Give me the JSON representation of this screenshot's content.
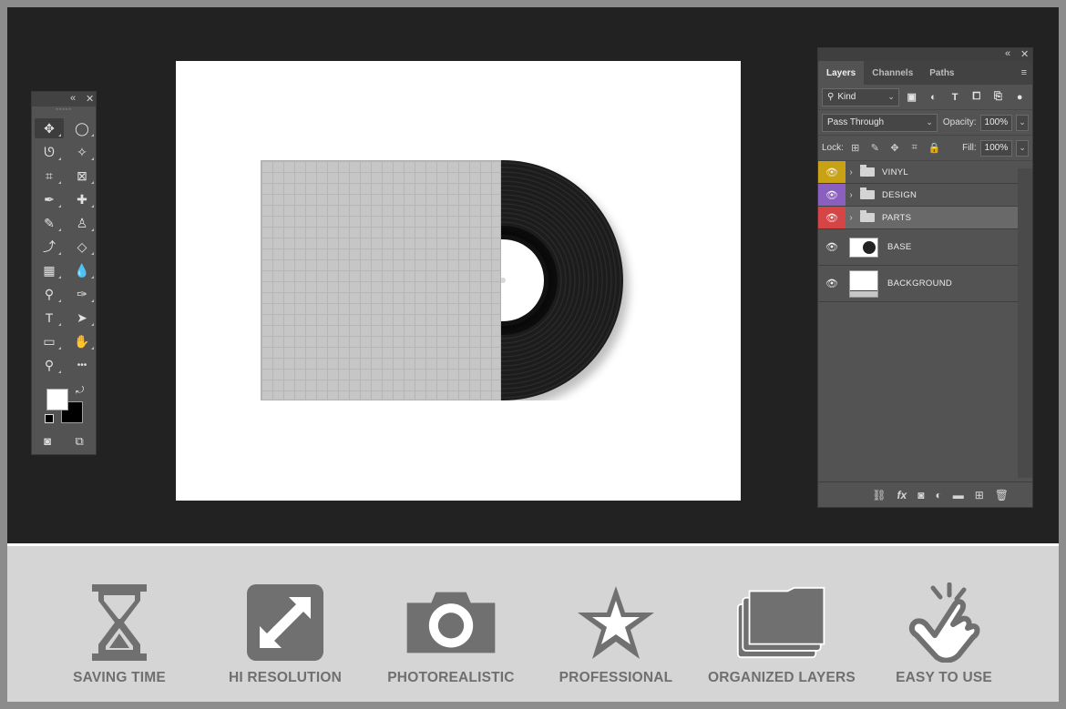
{
  "canvas": {
    "sleeve_color": "#c6c6c6",
    "record_color": "#1c1c1c"
  },
  "toolbar": {
    "tools": [
      {
        "name": "move-tool",
        "glyph": "✥",
        "active": true
      },
      {
        "name": "marquee-ellipse-tool",
        "glyph": "◯"
      },
      {
        "name": "lasso-tool",
        "glyph": "ᘎ"
      },
      {
        "name": "magic-wand-tool",
        "glyph": "✧"
      },
      {
        "name": "crop-tool",
        "glyph": "⌗"
      },
      {
        "name": "frame-tool",
        "glyph": "⊠"
      },
      {
        "name": "eyedropper-tool",
        "glyph": "✒"
      },
      {
        "name": "healing-brush-tool",
        "glyph": "✚"
      },
      {
        "name": "brush-tool",
        "glyph": "✎"
      },
      {
        "name": "clone-stamp-tool",
        "glyph": "♙"
      },
      {
        "name": "history-brush-tool",
        "glyph": "⤴"
      },
      {
        "name": "eraser-tool",
        "glyph": "◇"
      },
      {
        "name": "gradient-tool",
        "glyph": "▦"
      },
      {
        "name": "blur-tool",
        "glyph": "💧"
      },
      {
        "name": "dodge-tool",
        "glyph": "⚲"
      },
      {
        "name": "pen-tool",
        "glyph": "✑"
      },
      {
        "name": "type-tool",
        "glyph": "T"
      },
      {
        "name": "path-selection-tool",
        "glyph": "➤"
      },
      {
        "name": "rectangle-tool",
        "glyph": "▭"
      },
      {
        "name": "hand-tool",
        "glyph": "✋"
      },
      {
        "name": "zoom-tool",
        "glyph": "⚲"
      },
      {
        "name": "more-tools",
        "glyph": "•••"
      }
    ]
  },
  "layers_panel": {
    "tabs": [
      "Layers",
      "Channels",
      "Paths"
    ],
    "filter": {
      "label": "Kind"
    },
    "blend_mode": "Pass Through",
    "opacity_label": "Opacity:",
    "opacity_value": "100%",
    "lock_label": "Lock:",
    "fill_label": "Fill:",
    "fill_value": "100%",
    "layers": [
      {
        "name": "VINYL",
        "type": "group",
        "color": "#c9a114"
      },
      {
        "name": "DESIGN",
        "type": "group",
        "color": "#8b5fbf"
      },
      {
        "name": "PARTS",
        "type": "group",
        "color": "#d64545",
        "selected": true
      },
      {
        "name": "BASE",
        "type": "layer"
      },
      {
        "name": "BACKGROUND",
        "type": "layer"
      }
    ]
  },
  "features": [
    {
      "label": "SAVING TIME",
      "icon": "hourglass-icon"
    },
    {
      "label": "HI RESOLUTION",
      "icon": "expand-icon"
    },
    {
      "label": "PHOTOREALISTIC",
      "icon": "camera-icon"
    },
    {
      "label": "PROFESSIONAL",
      "icon": "star-icon"
    },
    {
      "label": "ORGANIZED LAYERS",
      "icon": "folders-icon"
    },
    {
      "label": "EASY TO USE",
      "icon": "click-hand-icon"
    }
  ],
  "colors": {
    "workspace": "#222222",
    "panel": "#535353",
    "feature_icon": "#707070"
  }
}
